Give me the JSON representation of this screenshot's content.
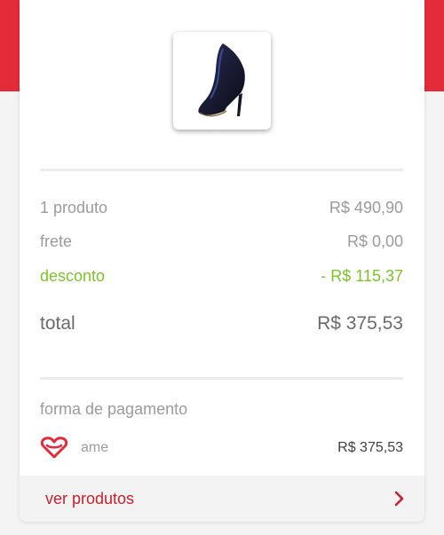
{
  "product": {
    "image_icon": "high-heel-shoe-icon"
  },
  "summary": {
    "items_label": "1 produto",
    "items_value": "R$ 490,90",
    "shipping_label": "frete",
    "shipping_value": "R$ 0,00",
    "discount_label": "desconto",
    "discount_value": "- R$ 115,37",
    "total_label": "total",
    "total_value": "R$ 375,53"
  },
  "payment": {
    "section_title": "forma de pagamento",
    "method_icon": "ame-heart-icon",
    "method_label": "ame",
    "method_amount": "R$ 375,53"
  },
  "footer": {
    "label": "ver produtos",
    "icon": "chevron-right-icon"
  },
  "colors": {
    "brand_red": "#e42b3a",
    "discount_green": "#7cc428"
  }
}
